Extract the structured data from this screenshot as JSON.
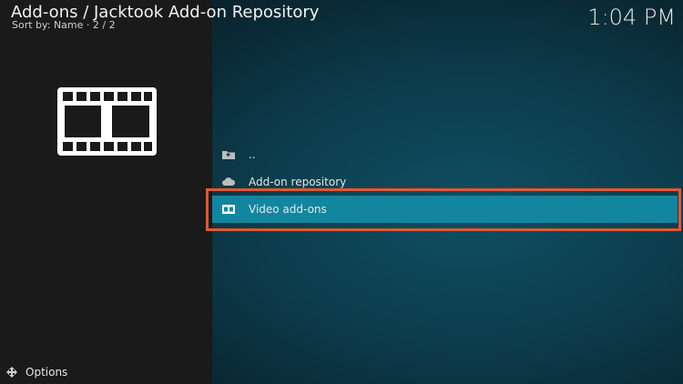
{
  "header": {
    "title": "Add-ons / Jacktook Add-on Repository",
    "sort_info": "Sort by: Name  · 2 / 2",
    "clock": "1:04 PM"
  },
  "content_icon": "film-strip-icon",
  "list": {
    "items": [
      {
        "label": "..",
        "icon": "folder-back-icon"
      },
      {
        "label": "Add-on repository",
        "icon": "cloud-icon"
      },
      {
        "label": "Video add-ons",
        "icon": "film-icon",
        "focused": true
      }
    ]
  },
  "footer": {
    "options_label": "Options",
    "options_icon": "options-arrows-icon"
  },
  "colors": {
    "focus_bg": "#12869f",
    "highlight_border": "#e4572e",
    "left_panel": "#1a1a1a"
  }
}
